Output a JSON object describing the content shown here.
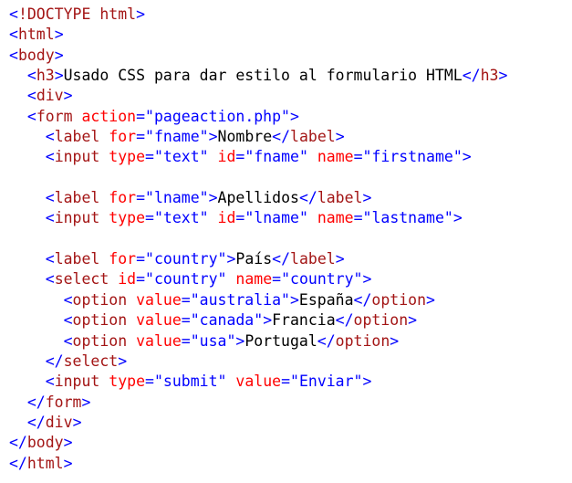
{
  "colors": {
    "bracket": "#0000ff",
    "tag": "#a31515",
    "attribute": "#ff0000",
    "value": "#0000ff",
    "text": "#000000",
    "background": "#ffffff"
  },
  "lines": [
    {
      "indent": "",
      "tokens": [
        {
          "k": "b",
          "t": "<"
        },
        {
          "k": "m",
          "t": "!DOCTYPE html"
        },
        {
          "k": "b",
          "t": ">"
        }
      ]
    },
    {
      "indent": "",
      "tokens": [
        {
          "k": "b",
          "t": "<"
        },
        {
          "k": "m",
          "t": "html"
        },
        {
          "k": "b",
          "t": ">"
        }
      ]
    },
    {
      "indent": "",
      "tokens": [
        {
          "k": "b",
          "t": "<"
        },
        {
          "k": "m",
          "t": "body"
        },
        {
          "k": "b",
          "t": ">"
        }
      ]
    },
    {
      "indent": "  ",
      "tokens": [
        {
          "k": "b",
          "t": "<"
        },
        {
          "k": "m",
          "t": "h3"
        },
        {
          "k": "b",
          "t": ">"
        },
        {
          "k": "t",
          "t": "Usado CSS para dar estilo al formulario HTML"
        },
        {
          "k": "b",
          "t": "</"
        },
        {
          "k": "m",
          "t": "h3"
        },
        {
          "k": "b",
          "t": ">"
        }
      ]
    },
    {
      "indent": "  ",
      "tokens": [
        {
          "k": "b",
          "t": "<"
        },
        {
          "k": "m",
          "t": "div"
        },
        {
          "k": "b",
          "t": ">"
        }
      ]
    },
    {
      "indent": "  ",
      "tokens": [
        {
          "k": "b",
          "t": "<"
        },
        {
          "k": "m",
          "t": "form"
        },
        {
          "k": "t",
          "t": " "
        },
        {
          "k": "r",
          "t": "action"
        },
        {
          "k": "b",
          "t": "="
        },
        {
          "k": "s",
          "t": "\"pageaction.php\""
        },
        {
          "k": "b",
          "t": ">"
        }
      ]
    },
    {
      "indent": "    ",
      "tokens": [
        {
          "k": "b",
          "t": "<"
        },
        {
          "k": "m",
          "t": "label"
        },
        {
          "k": "t",
          "t": " "
        },
        {
          "k": "r",
          "t": "for"
        },
        {
          "k": "b",
          "t": "="
        },
        {
          "k": "s",
          "t": "\"fname\""
        },
        {
          "k": "b",
          "t": ">"
        },
        {
          "k": "t",
          "t": "Nombre"
        },
        {
          "k": "b",
          "t": "</"
        },
        {
          "k": "m",
          "t": "label"
        },
        {
          "k": "b",
          "t": ">"
        }
      ]
    },
    {
      "indent": "    ",
      "tokens": [
        {
          "k": "b",
          "t": "<"
        },
        {
          "k": "m",
          "t": "input"
        },
        {
          "k": "t",
          "t": " "
        },
        {
          "k": "r",
          "t": "type"
        },
        {
          "k": "b",
          "t": "="
        },
        {
          "k": "s",
          "t": "\"text\""
        },
        {
          "k": "t",
          "t": " "
        },
        {
          "k": "r",
          "t": "id"
        },
        {
          "k": "b",
          "t": "="
        },
        {
          "k": "s",
          "t": "\"fname\""
        },
        {
          "k": "t",
          "t": " "
        },
        {
          "k": "r",
          "t": "name"
        },
        {
          "k": "b",
          "t": "="
        },
        {
          "k": "s",
          "t": "\"firstname\""
        },
        {
          "k": "b",
          "t": ">"
        }
      ]
    },
    {
      "indent": "",
      "tokens": []
    },
    {
      "indent": "    ",
      "tokens": [
        {
          "k": "b",
          "t": "<"
        },
        {
          "k": "m",
          "t": "label"
        },
        {
          "k": "t",
          "t": " "
        },
        {
          "k": "r",
          "t": "for"
        },
        {
          "k": "b",
          "t": "="
        },
        {
          "k": "s",
          "t": "\"lname\""
        },
        {
          "k": "b",
          "t": ">"
        },
        {
          "k": "t",
          "t": "Apellidos"
        },
        {
          "k": "b",
          "t": "</"
        },
        {
          "k": "m",
          "t": "label"
        },
        {
          "k": "b",
          "t": ">"
        }
      ]
    },
    {
      "indent": "    ",
      "tokens": [
        {
          "k": "b",
          "t": "<"
        },
        {
          "k": "m",
          "t": "input"
        },
        {
          "k": "t",
          "t": " "
        },
        {
          "k": "r",
          "t": "type"
        },
        {
          "k": "b",
          "t": "="
        },
        {
          "k": "s",
          "t": "\"text\""
        },
        {
          "k": "t",
          "t": " "
        },
        {
          "k": "r",
          "t": "id"
        },
        {
          "k": "b",
          "t": "="
        },
        {
          "k": "s",
          "t": "\"lname\""
        },
        {
          "k": "t",
          "t": " "
        },
        {
          "k": "r",
          "t": "name"
        },
        {
          "k": "b",
          "t": "="
        },
        {
          "k": "s",
          "t": "\"lastname\""
        },
        {
          "k": "b",
          "t": ">"
        }
      ]
    },
    {
      "indent": "",
      "tokens": []
    },
    {
      "indent": "    ",
      "tokens": [
        {
          "k": "b",
          "t": "<"
        },
        {
          "k": "m",
          "t": "label"
        },
        {
          "k": "t",
          "t": " "
        },
        {
          "k": "r",
          "t": "for"
        },
        {
          "k": "b",
          "t": "="
        },
        {
          "k": "s",
          "t": "\"country\""
        },
        {
          "k": "b",
          "t": ">"
        },
        {
          "k": "t",
          "t": "País"
        },
        {
          "k": "b",
          "t": "</"
        },
        {
          "k": "m",
          "t": "label"
        },
        {
          "k": "b",
          "t": ">"
        }
      ]
    },
    {
      "indent": "    ",
      "tokens": [
        {
          "k": "b",
          "t": "<"
        },
        {
          "k": "m",
          "t": "select"
        },
        {
          "k": "t",
          "t": " "
        },
        {
          "k": "r",
          "t": "id"
        },
        {
          "k": "b",
          "t": "="
        },
        {
          "k": "s",
          "t": "\"country\""
        },
        {
          "k": "t",
          "t": " "
        },
        {
          "k": "r",
          "t": "name"
        },
        {
          "k": "b",
          "t": "="
        },
        {
          "k": "s",
          "t": "\"country\""
        },
        {
          "k": "b",
          "t": ">"
        }
      ]
    },
    {
      "indent": "      ",
      "tokens": [
        {
          "k": "b",
          "t": "<"
        },
        {
          "k": "m",
          "t": "option"
        },
        {
          "k": "t",
          "t": " "
        },
        {
          "k": "r",
          "t": "value"
        },
        {
          "k": "b",
          "t": "="
        },
        {
          "k": "s",
          "t": "\"australia\""
        },
        {
          "k": "b",
          "t": ">"
        },
        {
          "k": "t",
          "t": "España"
        },
        {
          "k": "b",
          "t": "</"
        },
        {
          "k": "m",
          "t": "option"
        },
        {
          "k": "b",
          "t": ">"
        }
      ]
    },
    {
      "indent": "      ",
      "tokens": [
        {
          "k": "b",
          "t": "<"
        },
        {
          "k": "m",
          "t": "option"
        },
        {
          "k": "t",
          "t": " "
        },
        {
          "k": "r",
          "t": "value"
        },
        {
          "k": "b",
          "t": "="
        },
        {
          "k": "s",
          "t": "\"canada\""
        },
        {
          "k": "b",
          "t": ">"
        },
        {
          "k": "t",
          "t": "Francia"
        },
        {
          "k": "b",
          "t": "</"
        },
        {
          "k": "m",
          "t": "option"
        },
        {
          "k": "b",
          "t": ">"
        }
      ]
    },
    {
      "indent": "      ",
      "tokens": [
        {
          "k": "b",
          "t": "<"
        },
        {
          "k": "m",
          "t": "option"
        },
        {
          "k": "t",
          "t": " "
        },
        {
          "k": "r",
          "t": "value"
        },
        {
          "k": "b",
          "t": "="
        },
        {
          "k": "s",
          "t": "\"usa\""
        },
        {
          "k": "b",
          "t": ">"
        },
        {
          "k": "t",
          "t": "Portugal"
        },
        {
          "k": "b",
          "t": "</"
        },
        {
          "k": "m",
          "t": "option"
        },
        {
          "k": "b",
          "t": ">"
        }
      ]
    },
    {
      "indent": "    ",
      "tokens": [
        {
          "k": "b",
          "t": "</"
        },
        {
          "k": "m",
          "t": "select"
        },
        {
          "k": "b",
          "t": ">"
        }
      ]
    },
    {
      "indent": "    ",
      "tokens": [
        {
          "k": "b",
          "t": "<"
        },
        {
          "k": "m",
          "t": "input"
        },
        {
          "k": "t",
          "t": " "
        },
        {
          "k": "r",
          "t": "type"
        },
        {
          "k": "b",
          "t": "="
        },
        {
          "k": "s",
          "t": "\"submit\""
        },
        {
          "k": "t",
          "t": " "
        },
        {
          "k": "r",
          "t": "value"
        },
        {
          "k": "b",
          "t": "="
        },
        {
          "k": "s",
          "t": "\"Enviar\""
        },
        {
          "k": "b",
          "t": ">"
        }
      ]
    },
    {
      "indent": "  ",
      "tokens": [
        {
          "k": "b",
          "t": "</"
        },
        {
          "k": "m",
          "t": "form"
        },
        {
          "k": "b",
          "t": ">"
        }
      ]
    },
    {
      "indent": "  ",
      "tokens": [
        {
          "k": "b",
          "t": "</"
        },
        {
          "k": "m",
          "t": "div"
        },
        {
          "k": "b",
          "t": ">"
        }
      ]
    },
    {
      "indent": "",
      "tokens": [
        {
          "k": "b",
          "t": "</"
        },
        {
          "k": "m",
          "t": "body"
        },
        {
          "k": "b",
          "t": ">"
        }
      ]
    },
    {
      "indent": "",
      "tokens": [
        {
          "k": "b",
          "t": "</"
        },
        {
          "k": "m",
          "t": "html"
        },
        {
          "k": "b",
          "t": ">"
        }
      ]
    }
  ]
}
